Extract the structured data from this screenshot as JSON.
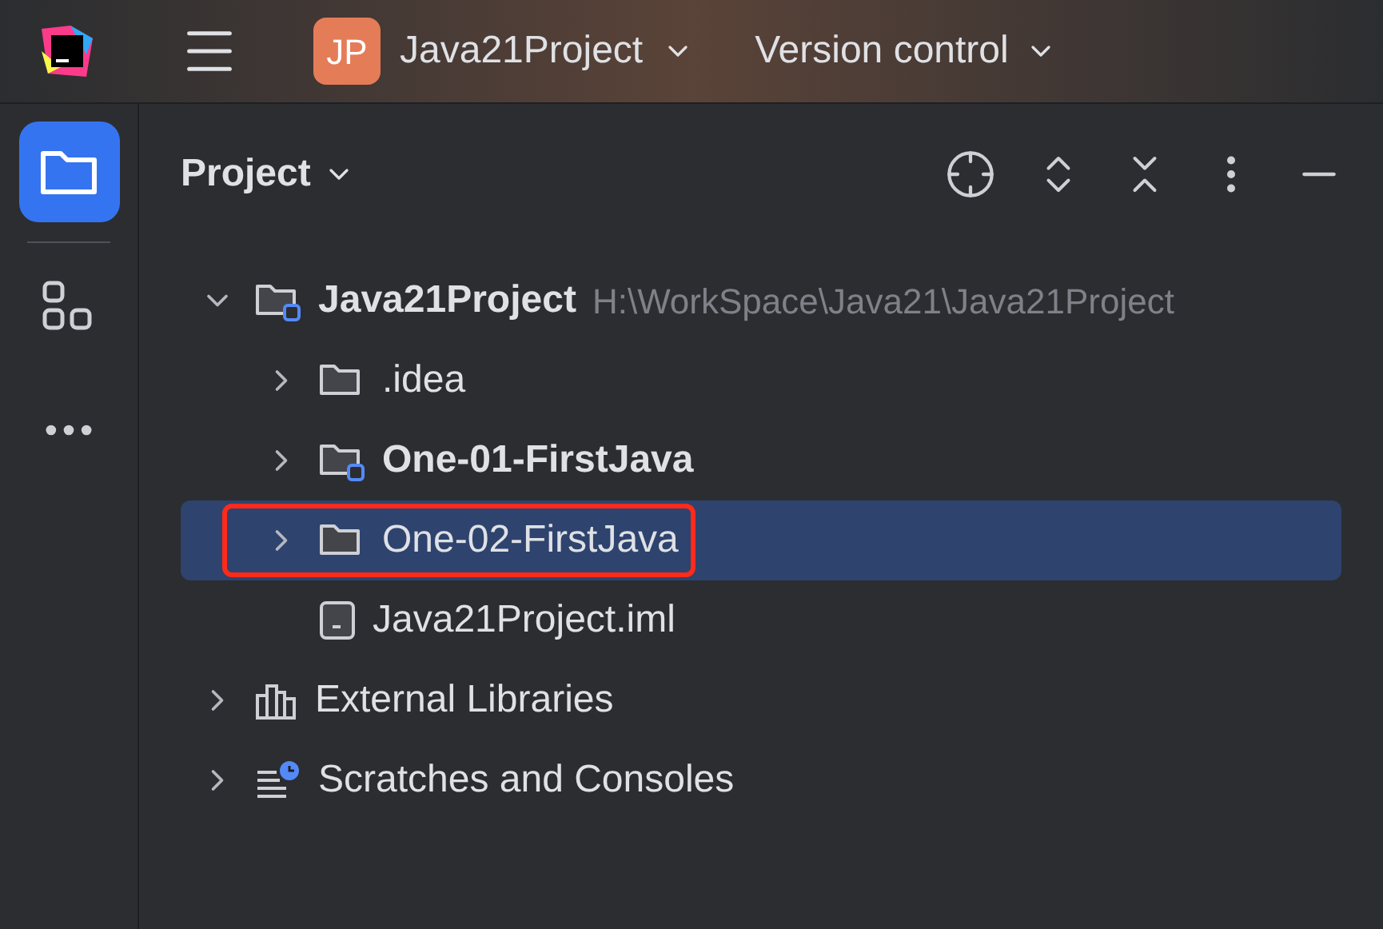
{
  "topbar": {
    "project_badge": "JP",
    "project_name": "Java21Project",
    "version_control": "Version control"
  },
  "panel": {
    "title": "Project"
  },
  "tree": [
    {
      "kind": "module",
      "name": "Java21Project",
      "path": "H:\\WorkSpace\\Java21\\Java21Project",
      "bold": true,
      "expanded": true,
      "selected": false,
      "highlighted": false,
      "children": [
        {
          "kind": "folder",
          "name": ".idea",
          "bold": false,
          "expanded": false,
          "selected": false,
          "highlighted": false
        },
        {
          "kind": "module",
          "name": "One-01-FirstJava",
          "bold": true,
          "expanded": false,
          "selected": false,
          "highlighted": false
        },
        {
          "kind": "folder",
          "name": "One-02-FirstJava",
          "bold": false,
          "expanded": false,
          "selected": true,
          "highlighted": true
        },
        {
          "kind": "file",
          "name": "Java21Project.iml",
          "bold": false,
          "selected": false,
          "highlighted": false
        }
      ]
    },
    {
      "kind": "libraries",
      "name": "External Libraries",
      "bold": false,
      "expanded": false,
      "selected": false,
      "highlighted": false
    },
    {
      "kind": "scratches",
      "name": "Scratches and Consoles",
      "bold": false,
      "expanded": false,
      "selected": false,
      "highlighted": false
    }
  ]
}
